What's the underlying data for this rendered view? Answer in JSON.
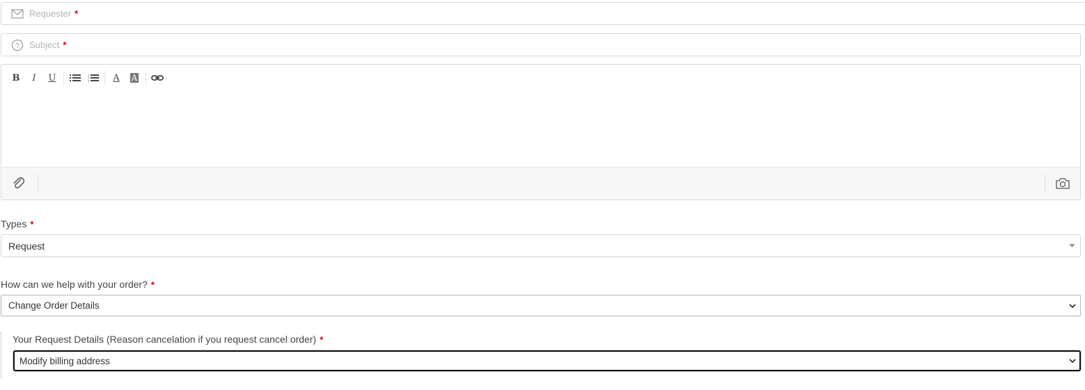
{
  "requester": {
    "placeholder": "Requester",
    "required_mark": "*"
  },
  "subject": {
    "placeholder": "Subject",
    "required_mark": "*"
  },
  "editor": {
    "toolbar": {
      "bold": "B",
      "italic": "I",
      "underline": "U",
      "font_color": "A",
      "highlight": "A"
    }
  },
  "types": {
    "label": "Types",
    "required_mark": "*",
    "value": "Request"
  },
  "order_help": {
    "label": "How can we help with your order?",
    "required_mark": "*",
    "value": "Change Order Details"
  },
  "request_details": {
    "label": "Your Request Details (Reason cancelation if you request cancel order)",
    "required_mark": "*",
    "value": "Modify billing address"
  },
  "colors": {
    "required": "#d0021b",
    "border": "#d7d7d7",
    "footer_bg": "#f7f7f7"
  }
}
